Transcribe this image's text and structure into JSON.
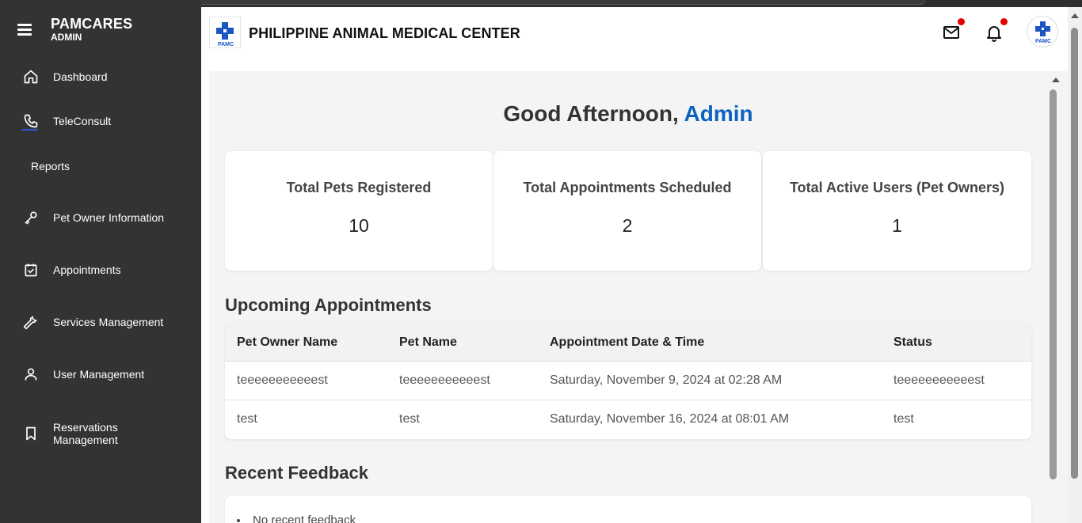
{
  "sidebar": {
    "brand_title": "PAMCARES",
    "brand_sub": "ADMIN",
    "items": [
      {
        "label": "Dashboard",
        "icon": "home-icon"
      },
      {
        "label": "TeleConsult",
        "icon": "phone-icon"
      },
      {
        "label": "Reports",
        "icon": ""
      },
      {
        "label": "Pet Owner Information",
        "icon": "key-icon"
      },
      {
        "label": "Appointments",
        "icon": "calendar-check-icon"
      },
      {
        "label": "Services Management",
        "icon": "wrench-icon"
      },
      {
        "label": "User Management",
        "icon": "user-icon"
      },
      {
        "label": "Reservations Management",
        "icon": "bookmark-icon"
      }
    ]
  },
  "header": {
    "title": "PHILIPPINE ANIMAL MEDICAL CENTER",
    "logo_text": "PAMC"
  },
  "main": {
    "greeting_prefix": "Good Afternoon, ",
    "greeting_name": "Admin",
    "cards": [
      {
        "title": "Total Pets Registered",
        "value": "10"
      },
      {
        "title": "Total Appointments Scheduled",
        "value": "2"
      },
      {
        "title": "Total Active Users (Pet Owners)",
        "value": "1"
      }
    ],
    "appointments_title": "Upcoming Appointments",
    "columns": [
      "Pet Owner Name",
      "Pet Name",
      "Appointment Date & Time",
      "Status"
    ],
    "rows": [
      [
        "teeeeeeeeeeest",
        "teeeeeeeeeeest",
        "Saturday, November 9, 2024 at 02:28 AM",
        "teeeeeeeeeeest"
      ],
      [
        "test",
        "test",
        "Saturday, November 16, 2024 at 08:01 AM",
        "test"
      ]
    ],
    "feedback_title": "Recent Feedback",
    "feedback_empty": "No recent feedback"
  },
  "colors": {
    "sidebar_bg": "#333333",
    "accent": "#0d62bf",
    "notification_dot": "#e40000",
    "logo_blue": "#1a56c4"
  }
}
